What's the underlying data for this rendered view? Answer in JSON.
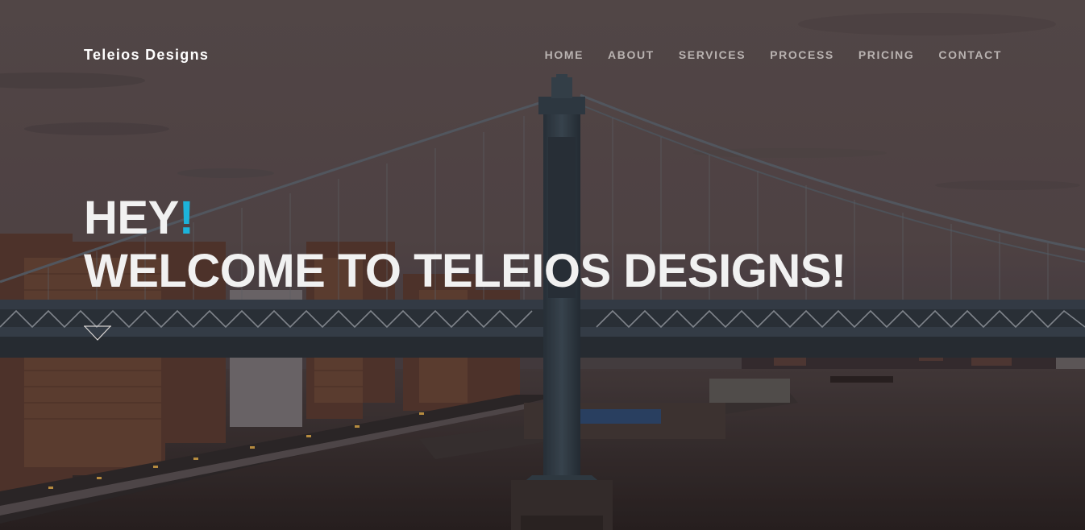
{
  "brand": {
    "name": "Teleios Designs"
  },
  "nav": {
    "items": [
      {
        "label": "HOME"
      },
      {
        "label": "ABOUT"
      },
      {
        "label": "SERVICES"
      },
      {
        "label": "PROCESS"
      },
      {
        "label": "PRICING"
      },
      {
        "label": "CONTACT"
      }
    ]
  },
  "hero": {
    "greeting": "HEY",
    "greeting_mark": "!",
    "welcome": "WELCOME TO TELEIOS DESIGNS!",
    "background_image": "bridge-photo",
    "scroll_icon": "down-chevron-icon"
  },
  "colors": {
    "accent": "#1cb3da",
    "headline": "#f1f1f1",
    "nav_text": "#b9b3b1",
    "brand_text": "#ffffff"
  }
}
